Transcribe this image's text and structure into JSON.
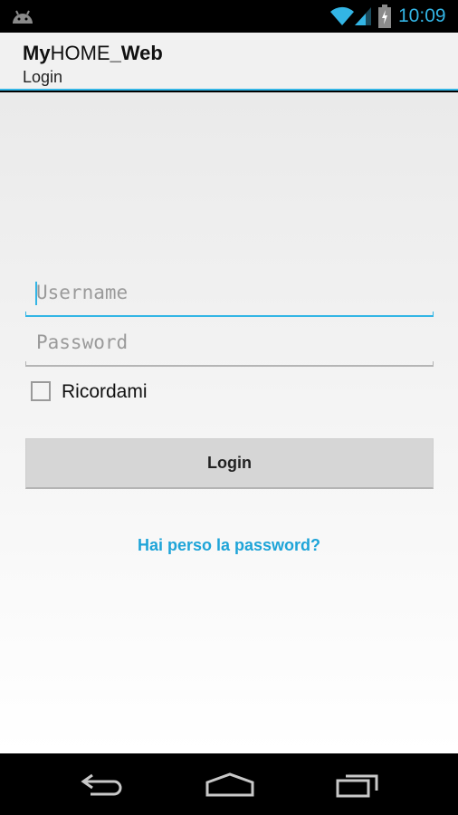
{
  "status_bar": {
    "time": "10:09",
    "icons": [
      "android-icon",
      "wifi-icon",
      "signal-icon",
      "battery-icon"
    ],
    "accent_color": "#33b5e5"
  },
  "action_bar": {
    "title_part1": "My",
    "title_part2": "HOME",
    "title_part3": "_Web",
    "subtitle": "Login"
  },
  "form": {
    "username_placeholder": "Username",
    "password_placeholder": "Password",
    "remember_label": "Ricordami",
    "remember_checked": false,
    "login_label": "Login",
    "forgot_password_link": "Hai perso la password?"
  },
  "nav_bar": {
    "icons": [
      "back-icon",
      "home-icon",
      "recents-icon"
    ]
  },
  "colors": {
    "accent": "#33b5e5",
    "link": "#1ea4d8",
    "button_bg": "#d6d6d6"
  }
}
